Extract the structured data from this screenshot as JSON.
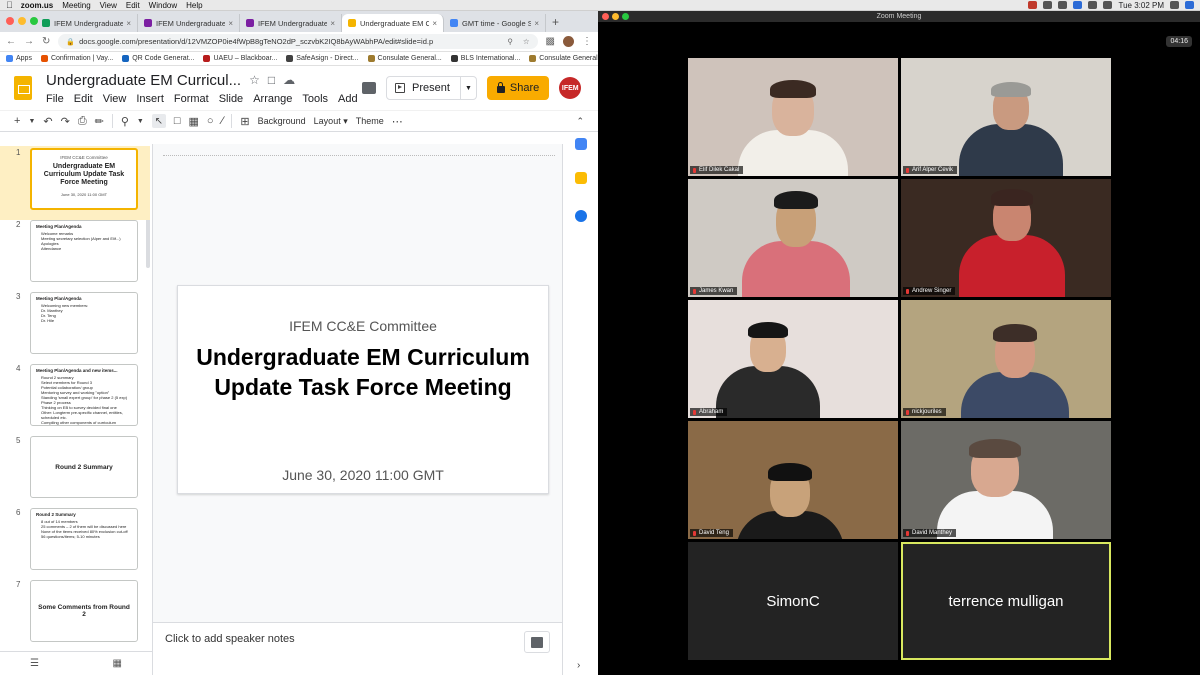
{
  "menubar": {
    "app": "zoom.us",
    "items": [
      "Meeting",
      "View",
      "Edit",
      "Window",
      "Help"
    ],
    "clock": "Tue 3:02 PM"
  },
  "browser": {
    "tabs": [
      {
        "label": "IFEM Undergraduate EM Cu",
        "color": "#0f9d58",
        "active": false
      },
      {
        "label": "IFEM Undergraduate EM Cu",
        "color": "#7b1fa2",
        "active": false
      },
      {
        "label": "IFEM Undergraduate EM Cu",
        "color": "#7b1fa2",
        "active": false
      },
      {
        "label": "Undergraduate EM Curricu",
        "color": "#f4b400",
        "active": true
      },
      {
        "label": "GMT time - Google Search",
        "color": "#4285f4",
        "active": false
      }
    ],
    "url": "docs.google.com/presentation/d/12VMZOP0ie4fWpB8gTeNO2dP_sczvbK2IQ8bAyWAbhPA/edit#slide=id.p",
    "bookmarks": [
      {
        "label": "Apps",
        "color": "#4285f4"
      },
      {
        "label": "Confirmation | Vay...",
        "color": "#e65100"
      },
      {
        "label": "QR Code Generat...",
        "color": "#1565c0"
      },
      {
        "label": "UAEU – Blackboar...",
        "color": "#b71c1c"
      },
      {
        "label": "SafeAsign - Direct...",
        "color": "#424242"
      },
      {
        "label": "Consulate General...",
        "color": "#9e7b2f"
      },
      {
        "label": "BLS International...",
        "color": "#333333"
      },
      {
        "label": "Consulate General...",
        "color": "#9e7b2f"
      }
    ]
  },
  "slides": {
    "doc_title": "Undergraduate EM Curricul...",
    "menus": [
      "File",
      "Edit",
      "View",
      "Insert",
      "Format",
      "Slide",
      "Arrange",
      "Tools",
      "Add"
    ],
    "present_label": "Present",
    "share_label": "Share",
    "logo_text": "IFEM",
    "toolbar": {
      "background": "Background",
      "layout": "Layout",
      "theme": "Theme"
    },
    "thumbs": [
      {
        "num": "1",
        "kind": "title",
        "small": "IFEM CC&E Committee",
        "big": "Undergraduate EM Curriculum Update Task Force Meeting",
        "date": "June 30, 2020 11:00 GMT"
      },
      {
        "num": "2",
        "kind": "list",
        "heading": "Meeting Plan/Agenda",
        "items": [
          "Welcome remarks",
          "Meeting secretary selection (Alper and Elif...)",
          "Apologies",
          "Attendance"
        ]
      },
      {
        "num": "3",
        "kind": "list",
        "heading": "Meeting Plan/Agenda",
        "items": [
          "Welcoming new members:",
          "Dr. Manthey",
          "Dr. Teng",
          "Dr. Hile"
        ]
      },
      {
        "num": "4",
        "kind": "list",
        "heading": "Meeting Plan/Agenda and new items...",
        "items": [
          "Round 2 summary",
          "Select members for Round 3",
          "Potential collaboration/ group",
          "Mentoring survey and working \"option\"",
          "Standing 'small expert group' for phase 2 (5 exp)",
          "Phase 2 process",
          "Thinking on EB to survey decided final one",
          "Other: Longterm pre-specific channel, entities, scheduled etc.",
          "Compiling other components of curriculum",
          "Next items?"
        ]
      },
      {
        "num": "5",
        "kind": "center",
        "big": "Round 2 Summary"
      },
      {
        "num": "6",
        "kind": "list",
        "heading": "Round 2 Summary",
        "items": [
          "8 out of 14 members",
          "25 comments – 2 of them will be discussed here",
          "None of the items received 80% exclusion cut-off",
          "",
          "56 questions/items; 5-10 minutes"
        ]
      },
      {
        "num": "7",
        "kind": "center",
        "big": "Some Comments from Round 2"
      }
    ],
    "main_slide": {
      "subtitle": "IFEM CC&E Committee",
      "title": "Undergraduate EM Curriculum Update Task Force Meeting",
      "date": "June 30, 2020 11:00 GMT"
    },
    "notes_placeholder": "Click to add speaker notes"
  },
  "zoom": {
    "window_title": "Zoom Meeting",
    "timer": "04:16",
    "participants": [
      {
        "name": "Elif Dilek Cakal",
        "bg": "#cfc3bb"
      },
      {
        "name": "Arif Alper Cevik",
        "bg": "#d7d3cc"
      },
      {
        "name": "James Kwan",
        "bg": "#cfcac4"
      },
      {
        "name": "Andrew Singer",
        "bg": "#3a2a22"
      },
      {
        "name": "Abraham",
        "bg": "#e7dfdc"
      },
      {
        "name": "nickjouriles",
        "bg": "#b4a47f"
      },
      {
        "name": "David Teng",
        "bg": "#8a6a47"
      },
      {
        "name": "David Manthey",
        "bg": "#6c6b66"
      },
      {
        "name": "SimonC",
        "bg": "#232323"
      },
      {
        "name": "terrence mulligan",
        "bg": "#232323"
      }
    ]
  }
}
